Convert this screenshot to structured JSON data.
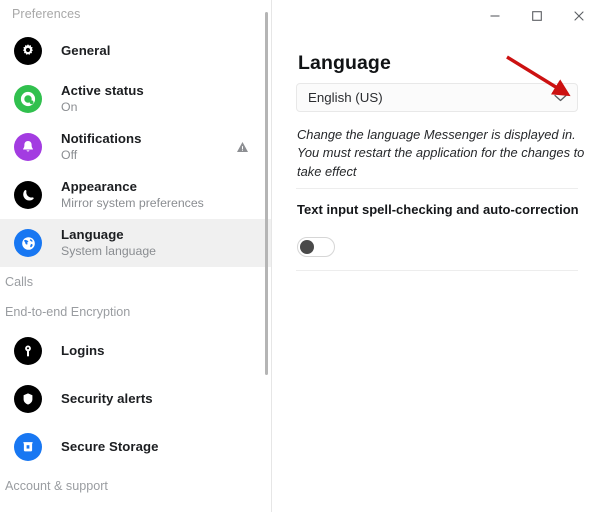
{
  "window": {
    "minimize_label": "–",
    "maximize_label": "□",
    "close_label": "×"
  },
  "sidebar": {
    "header": "Preferences",
    "items": [
      {
        "type": "item",
        "label": "General",
        "sublabel": "",
        "icon": "gear-icon",
        "icon_bg": "#000000",
        "selected": false,
        "badge": ""
      },
      {
        "type": "item",
        "label": "Active status",
        "sublabel": "On",
        "icon": "active-status-icon",
        "icon_bg": "#31c04e",
        "selected": false,
        "badge": ""
      },
      {
        "type": "item",
        "label": "Notifications",
        "sublabel": "Off",
        "icon": "bell-icon",
        "icon_bg": "#a33ce1",
        "selected": false,
        "badge": "warning-triangle-icon"
      },
      {
        "type": "item",
        "label": "Appearance",
        "sublabel": "Mirror system preferences",
        "icon": "moon-icon",
        "icon_bg": "#000000",
        "selected": false,
        "badge": ""
      },
      {
        "type": "item",
        "label": "Language",
        "sublabel": "System language",
        "icon": "globe-icon",
        "icon_bg": "#1877f2",
        "selected": true,
        "badge": ""
      },
      {
        "type": "section",
        "label": "Calls",
        "sublabel": "",
        "icon": "",
        "icon_bg": "",
        "selected": false,
        "badge": ""
      },
      {
        "type": "section",
        "label": "End-to-end Encryption",
        "sublabel": "",
        "icon": "",
        "icon_bg": "",
        "selected": false,
        "badge": ""
      },
      {
        "type": "item",
        "label": "Logins",
        "sublabel": "",
        "icon": "key-icon",
        "icon_bg": "#000000",
        "selected": false,
        "badge": ""
      },
      {
        "type": "item",
        "label": "Security alerts",
        "sublabel": "",
        "icon": "shield-icon",
        "icon_bg": "#000000",
        "selected": false,
        "badge": ""
      },
      {
        "type": "item",
        "label": "Secure Storage",
        "sublabel": "",
        "icon": "vault-icon",
        "icon_bg": "#1877f2",
        "selected": false,
        "badge": ""
      },
      {
        "type": "section",
        "label": "Account & support",
        "sublabel": "",
        "icon": "",
        "icon_bg": "",
        "selected": false,
        "badge": ""
      }
    ]
  },
  "content": {
    "title": "Language",
    "language_dropdown": {
      "value": "English (US)",
      "chevron": "chevron-down-icon"
    },
    "description": "Change the language Messenger is displayed in. You must restart the application for the changes to take effect",
    "spell_check_label": "Text input spell-checking and auto-correction",
    "spell_check_toggle": {
      "state": "off"
    }
  },
  "annotation": {
    "arrow_color": "#cc1111",
    "target": "language-dropdown-chevron"
  },
  "colors": {
    "selected_row_bg": "#f0f0f0",
    "divider": "#ededed",
    "muted_text": "#8a8d91",
    "accent_blue": "#1877f2"
  }
}
